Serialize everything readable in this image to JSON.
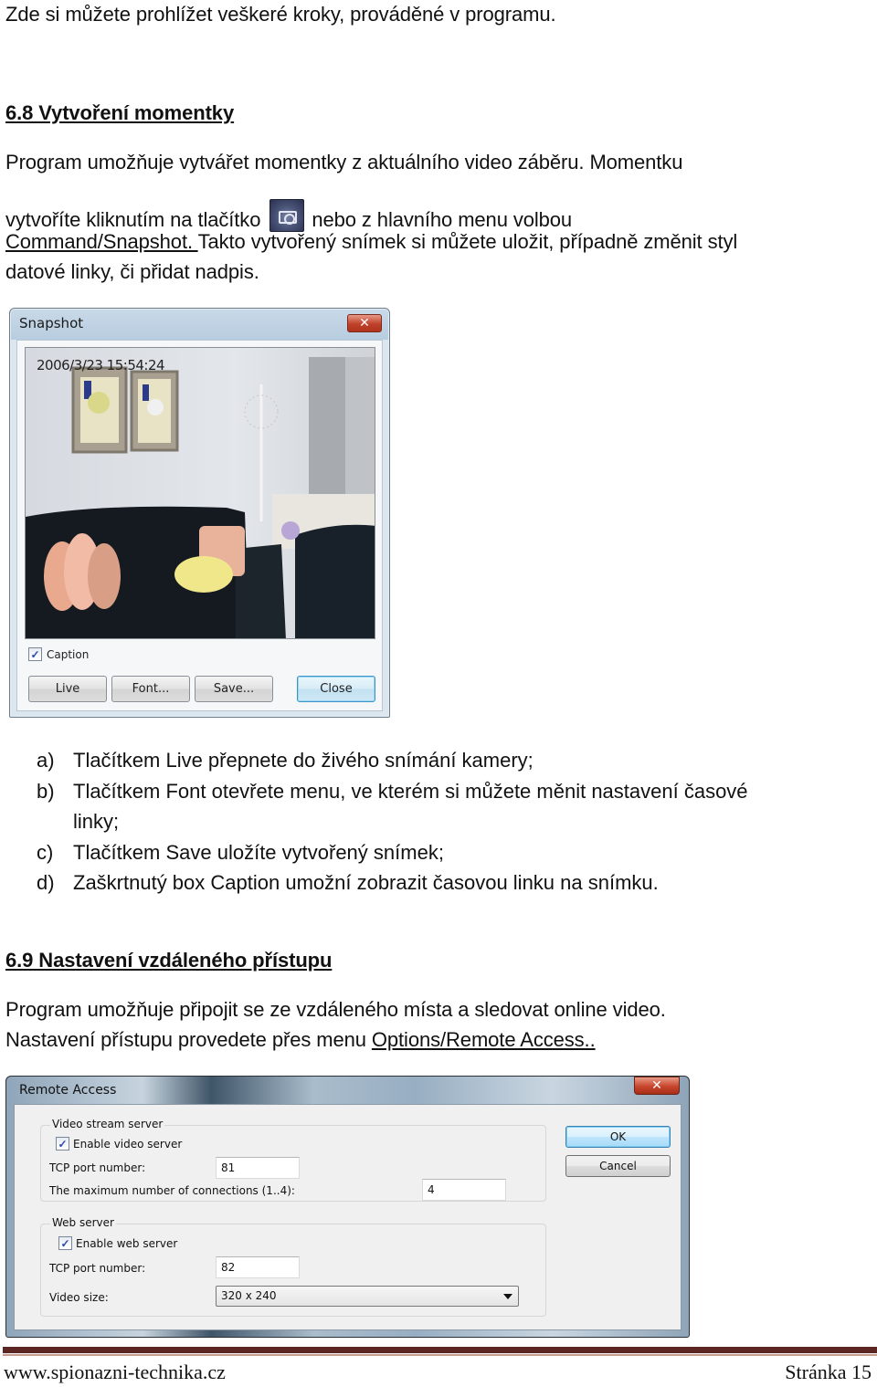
{
  "intro_line": "Zde si můžete prohlížet veškeré kroky, prováděné v programu.",
  "section_68": {
    "heading": "6.8 Vytvoření momentky",
    "para_line1": "Program umožňuje vytvářet momentky z aktuálního video záběru. Momentku",
    "para_line2_before_icon": "vytvoříte kliknutím na tlačítko",
    "inline_icon": "snapshot-camera-icon",
    "para_line2_after_icon": "nebo z hlavního menu volbou",
    "para_line3_link": "Command/Snapshot. ",
    "para_line3_rest": "Takto vytvořený snímek si můžete uložit, případně změnit styl",
    "para_line4": "datové linky, či přidat nadpis."
  },
  "snapshot_window": {
    "title": "Snapshot",
    "close_glyph": "✕",
    "timestamp": "2006/3/23 15:54:24",
    "caption_checkbox": {
      "label": "Caption",
      "checked": true,
      "glyph": "✓"
    },
    "buttons": {
      "live": "Live",
      "font": "Font...",
      "save": "Save...",
      "close": "Close"
    }
  },
  "list": [
    {
      "mark": "a)",
      "text": "Tlačítkem Live přepnete do živého snímání kamery;"
    },
    {
      "mark": "b)",
      "text": "Tlačítkem Font otevřete menu, ve kterém si můžete měnit nastavení časové"
    },
    {
      "mark": "",
      "text": "linky;"
    },
    {
      "mark": "c)",
      "text": "Tlačítkem Save uložíte vytvořený snímek;"
    },
    {
      "mark": "d)",
      "text": "Zaškrtnutý box Caption umožní zobrazit časovou linku na snímku."
    }
  ],
  "section_69": {
    "heading": "6.9 Nastavení vzdáleného přístupu",
    "para_line1": "Program umožňuje připojit se ze vzdáleného místa a sledovat online video.",
    "para_line2_before_link": "Nastavení přístupu provedete přes menu ",
    "para_line2_link": "Options/Remote Access.."
  },
  "remote_access_window": {
    "title": "Remote Access",
    "close_glyph": "✕",
    "video_group": {
      "legend": "Video stream server",
      "enable_checkbox": {
        "label": "Enable video server",
        "checked": true,
        "glyph": "✓"
      },
      "tcp_label": "TCP port number:",
      "tcp_value": "81",
      "max_conn_label": "The maximum number of connections (1..4):",
      "max_conn_value": "4"
    },
    "web_group": {
      "legend": "Web server",
      "enable_checkbox": {
        "label": "Enable web server",
        "checked": true,
        "glyph": "✓"
      },
      "tcp_label": "TCP port number:",
      "tcp_value": "82",
      "video_size_label": "Video size:",
      "video_size_value": "320 x 240"
    },
    "buttons": {
      "ok": "OK",
      "cancel": "Cancel"
    }
  },
  "footer": {
    "website": "www.spionazni-technika.cz",
    "page_label": "Stránka 15"
  }
}
